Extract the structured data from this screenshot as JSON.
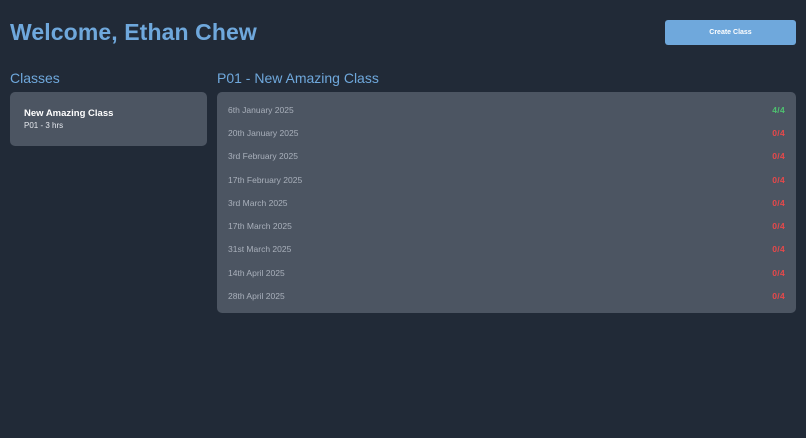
{
  "header": {
    "title": "Welcome, Ethan Chew",
    "create_button_label": "Create Class"
  },
  "classes": {
    "title": "Classes",
    "items": [
      {
        "name": "New Amazing Class",
        "meta": "P01 - 3 hrs"
      }
    ]
  },
  "detail": {
    "title": "P01 - New Amazing Class",
    "sessions": [
      {
        "date": "6th January 2025",
        "attendance": "4/4",
        "status": "full"
      },
      {
        "date": "20th January 2025",
        "attendance": "0/4",
        "status": "empty"
      },
      {
        "date": "3rd February 2025",
        "attendance": "0/4",
        "status": "empty"
      },
      {
        "date": "17th February 2025",
        "attendance": "0/4",
        "status": "empty"
      },
      {
        "date": "3rd March 2025",
        "attendance": "0/4",
        "status": "empty"
      },
      {
        "date": "17th March 2025",
        "attendance": "0/4",
        "status": "empty"
      },
      {
        "date": "31st March 2025",
        "attendance": "0/4",
        "status": "empty"
      },
      {
        "date": "14th April 2025",
        "attendance": "0/4",
        "status": "empty"
      },
      {
        "date": "28th April 2025",
        "attendance": "0/4",
        "status": "empty"
      }
    ]
  },
  "colors": {
    "background": "#212a37",
    "accent": "#6fa8dc",
    "panel": "#4c5562",
    "full": "#4ec26f",
    "empty": "#e8484a"
  }
}
